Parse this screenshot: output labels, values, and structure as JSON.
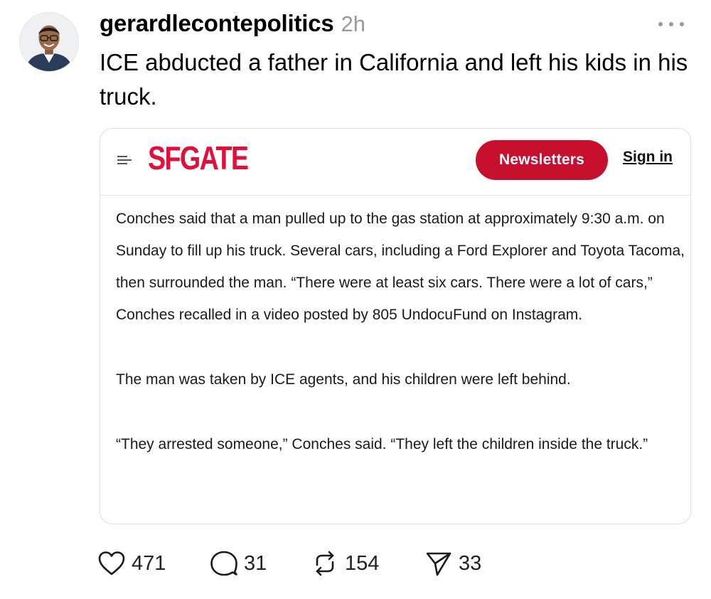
{
  "post": {
    "username": "gerardlecontepolitics",
    "timestamp": "2h",
    "text": "ICE abducted a father in California and left his kids in his truck.",
    "more_icon": "more-horizontal-icon"
  },
  "card": {
    "logo": "SFGATE",
    "newsletters_label": "Newsletters",
    "signin_label": "Sign in",
    "brand_color": "#e0103a",
    "button_color": "#c7102e",
    "paragraphs": [
      "Conches said that a man pulled up to the gas station at approximately 9:30 a.m. on Sunday to fill up his truck. Several cars, including a Ford Explorer and Toyota Tacoma, then surrounded the man. “There were at least six cars. There were a lot of cars,” Conches recalled in a video posted by 805 UndocuFund on Instagram.",
      "The man was taken by ICE agents, and his children were left behind.",
      "“They arrested someone,” Conches said. “They left the children inside the truck.”"
    ]
  },
  "actions": {
    "likes": "471",
    "replies": "31",
    "reposts": "154",
    "shares": "33"
  }
}
